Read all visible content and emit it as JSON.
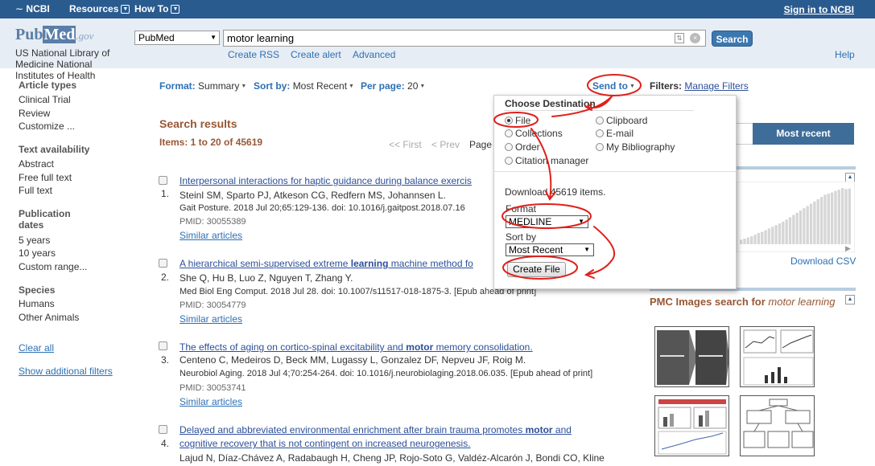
{
  "topbar": {
    "ncbi": "NCBI",
    "resources": "Resources",
    "howto": "How To",
    "signin": "Sign in to NCBI"
  },
  "header": {
    "logo_pub": "Pub",
    "logo_med": "Med",
    "logo_gov": ".gov",
    "nlm": "US National Library of Medicine National Institutes of Health",
    "db_select": "PubMed",
    "query": "motor learning",
    "search_button": "Search",
    "links": [
      "Create RSS",
      "Create alert",
      "Advanced"
    ],
    "help": "Help"
  },
  "sidebar": {
    "article_types": "Article types",
    "article_items": [
      "Clinical Trial",
      "Review",
      "Customize ..."
    ],
    "text_avail": "Text availability",
    "text_items": [
      "Abstract",
      "Free full text",
      "Full text"
    ],
    "pub_dates_1": "Publication",
    "pub_dates_2": "dates",
    "date_items": [
      "5 years",
      "10 years",
      "Custom range..."
    ],
    "species": "Species",
    "species_items": [
      "Humans",
      "Other Animals"
    ],
    "clear_all": "Clear all",
    "show_filters": "Show additional filters"
  },
  "toolbar": {
    "format_label": "Format:",
    "format_value": "Summary",
    "sortby_label": "Sort by:",
    "sortby_value": "Most Recent",
    "perpage_label": "Per page:",
    "perpage_value": "20",
    "sendto": "Send to",
    "filters_label": "Filters:",
    "manage_filters": "Manage Filters"
  },
  "results": {
    "title": "Search results",
    "count": "Items: 1 to 20 of 45619",
    "first": "<< First",
    "prev": "< Prev",
    "page": "Page",
    "items": [
      {
        "num": "1.",
        "title_pre": "Interpersonal interactions for haptic guidance during balance exercis",
        "title_bold": "",
        "title_post": "",
        "authors": "Steinl SM, Sparto PJ, Atkeson CG, Redfern MS, Johannsen L.",
        "source": "Gait Posture. 2018 Jul 20;65:129-136. doi: 10.1016/j.gaitpost.2018.07.16",
        "pmid": "PMID: 30055389",
        "similar": "Similar articles"
      },
      {
        "num": "2.",
        "title_pre": "A hierarchical semi-supervised extreme ",
        "title_bold": "learning",
        "title_post": " machine method fo",
        "authors": "She Q, Hu B, Luo Z, Nguyen T, Zhang Y.",
        "source": "Med Biol Eng Comput. 2018 Jul 28. doi: 10.1007/s11517-018-1875-3. [Epub ahead of print]",
        "pmid": "PMID: 30054779",
        "similar": "Similar articles"
      },
      {
        "num": "3.",
        "title_pre": "The effects of aging on cortico-spinal excitability and ",
        "title_bold": "motor",
        "title_post": " memory consolidation.",
        "authors": "Centeno C, Medeiros D, Beck MM, Lugassy L, Gonzalez DF, Nepveu JF, Roig M.",
        "source": "Neurobiol Aging. 2018 Jul 4;70:254-264. doi: 10.1016/j.neurobiolaging.2018.06.035. [Epub ahead of print]",
        "pmid": "PMID: 30053741",
        "similar": "Similar articles"
      },
      {
        "num": "4.",
        "title_pre": "Delayed and abbreviated environmental enrichment after brain trauma promotes ",
        "title_bold": "motor",
        "title_post": " and",
        "title_line2": "cognitive recovery that is not contingent on increased neurogenesis.",
        "authors": "Lajud N, Díaz-Chávez A, Radabaugh H, Cheng JP, Rojo-Soto G, Valdéz-Alcarón J, Bondi CO, Kline"
      }
    ]
  },
  "right": {
    "sort_tab": "Most recent",
    "download_csv": "Download CSV",
    "pmc_title": "PMC Images search for ",
    "pmc_query": "motor learning",
    "histogram_levels": [
      0.08,
      0.1,
      0.12,
      0.14,
      0.17,
      0.2,
      0.22,
      0.25,
      0.28,
      0.31,
      0.34,
      0.37,
      0.4,
      0.44,
      0.48,
      0.52,
      0.56,
      0.6,
      0.64,
      0.68,
      0.72,
      0.76,
      0.8,
      0.84,
      0.88,
      0.9,
      0.92,
      0.95,
      0.97,
      1.0,
      0.98,
      0.99
    ]
  },
  "sendto_menu": {
    "heading": "Choose Destination",
    "options_left": [
      "File",
      "Collections",
      "Order",
      "Citation manager"
    ],
    "options_right": [
      "Clipboard",
      "E-mail",
      "My Bibliography"
    ],
    "download_text": "Download 45619 items.",
    "format_label": "Format",
    "format_value": "MEDLINE",
    "sort_label": "Sort by",
    "sort_value": "Most Recent",
    "create_button": "Create File"
  },
  "colors": {
    "topbar": "#2a5b8f",
    "header_bg": "#e7edf4",
    "results_heading": "#985735",
    "link": "#2d70b3",
    "annotation": "#e0201b"
  }
}
